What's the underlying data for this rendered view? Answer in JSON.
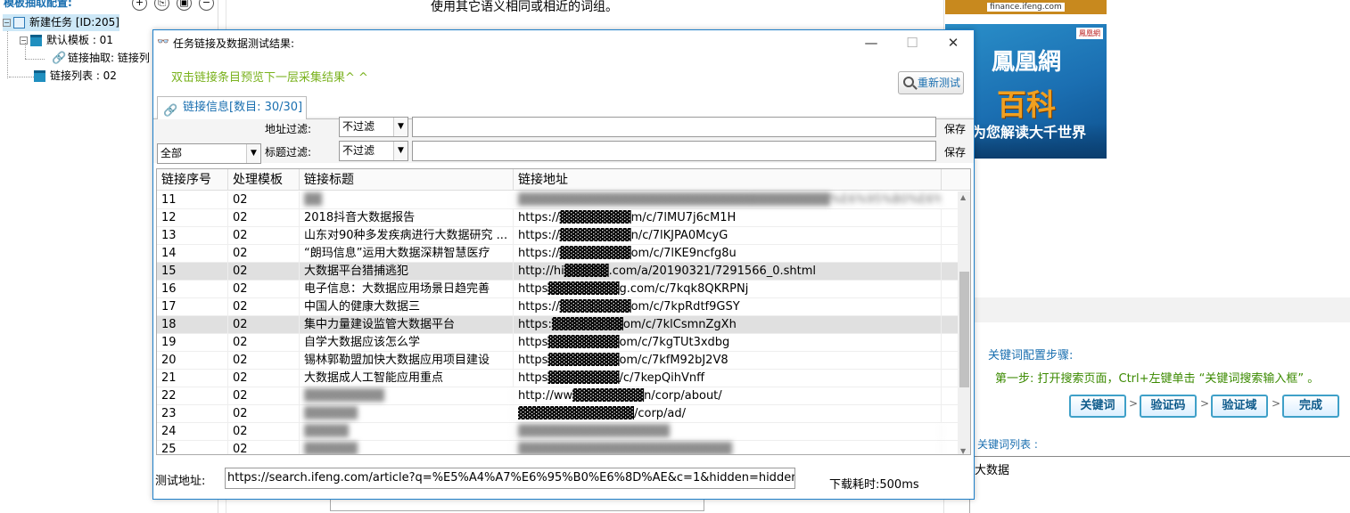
{
  "left_panel": {
    "title": "模板抽取配置:",
    "toolbar_icons": [
      "+",
      "⎘",
      "▣",
      "−"
    ],
    "tree": [
      {
        "label": "新建任务 [ID:205]",
        "level": 0
      },
      {
        "label": "默认模板 : 01",
        "level": 1
      },
      {
        "label": "链接抽取: 链接列",
        "level": 2
      },
      {
        "label": "链接列表 : 02",
        "level": 1
      }
    ]
  },
  "background": {
    "text": "使用其它语义相同或相近的词组。"
  },
  "ads": {
    "ad1_url": "finance.ifeng.com",
    "ad2_brand": "鳳凰網",
    "ad2_product": "百科",
    "ad2_slogan": "为您解读大千世界",
    "ad2_logo": "鳳凰網"
  },
  "right_panel": {
    "steps_title": "关键词配置步骤:",
    "step1": "第一步: 打开搜索页面，Ctrl+左键单击 “关键词搜索输入框” 。",
    "step_buttons": [
      "关键词",
      "验证码",
      "验证域",
      "完成"
    ],
    "keyword_list_label": "关键词列表 :",
    "keywords": [
      "大数据"
    ]
  },
  "dialog": {
    "title": "任务链接及数据测试结果:",
    "hint": "双击链接条目预览下一层采集结果^ ^",
    "retest_label": "重新测试",
    "tab_label": "链接信息[数目: 30/30]",
    "url_filter_label": "地址过滤:",
    "title_filter_label": "标题过滤:",
    "url_filter_value": "不过滤",
    "title_filter_value": "不过滤",
    "scope_value": "全部",
    "save_label": "保存",
    "columns": [
      "链接序号",
      "处理模板",
      "链接标题",
      "链接地址"
    ],
    "rows": [
      {
        "no": "11",
        "tpl": "02",
        "title": "▓▓",
        "url": "▓▓▓▓▓▓▓▓▓▓▓▓▓▓▓▓▓▓▓▓▓▓▓▓▓▓▓▓▓▓▓▓▓▓▓%E6%95%B0%E6%8...",
        "blur_title": true,
        "blur_url": true
      },
      {
        "no": "12",
        "tpl": "02",
        "title": "2018抖音大数据报告",
        "url": "https://▓▓▓▓▓▓▓▓m/c/7lMU7j6cM1H"
      },
      {
        "no": "13",
        "tpl": "02",
        "title": "山东对90种多发疾病进行大数据研究 ...",
        "url": "https://▓▓▓▓▓▓▓▓n/c/7lKJPA0McyG"
      },
      {
        "no": "14",
        "tpl": "02",
        "title": "“朗玛信息”运用大数据深耕智慧医疗",
        "url": "https://▓▓▓▓▓▓▓▓om/c/7lKE9ncfg8u"
      },
      {
        "no": "15",
        "tpl": "02",
        "title": "大数据平台猎捕逃犯",
        "url": "http://hi▓▓▓▓▓.com/a/20190321/7291566_0.shtml",
        "selected": true
      },
      {
        "no": "16",
        "tpl": "02",
        "title": "电子信息：大数据应用场景日趋完善",
        "url": "https▓▓▓▓▓▓▓▓g.com/c/7kqk8QKRPNj"
      },
      {
        "no": "17",
        "tpl": "02",
        "title": "中国人的健康大数据三",
        "url": "https://▓▓▓▓▓▓▓▓om/c/7kpRdtf9GSY"
      },
      {
        "no": "18",
        "tpl": "02",
        "title": "集中力量建设监管大数据平台",
        "url": "https:▓▓▓▓▓▓▓▓om/c/7klCsmnZgXh",
        "selected": true
      },
      {
        "no": "19",
        "tpl": "02",
        "title": "自学大数据应该怎么学",
        "url": "https▓▓▓▓▓▓▓▓om/c/7kgTUt3xdbg"
      },
      {
        "no": "20",
        "tpl": "02",
        "title": "锡林郭勒盟加快大数据应用项目建设",
        "url": "https▓▓▓▓▓▓▓▓om/c/7kfM92bJ2V8"
      },
      {
        "no": "21",
        "tpl": "02",
        "title": "大数据成人工智能应用重点",
        "url": "https▓▓▓▓▓▓▓▓/c/7kepQihVnff"
      },
      {
        "no": "22",
        "tpl": "02",
        "title": "▓▓▓▓▓▓▓▓▓",
        "url": "http://ww▓▓▓▓▓▓▓▓n/corp/about/",
        "blur_title": true
      },
      {
        "no": "23",
        "tpl": "02",
        "title": "▓▓▓▓▓▓",
        "url": "▓▓▓▓▓▓▓▓▓▓▓▓▓/corp/ad/",
        "blur_title": true
      },
      {
        "no": "24",
        "tpl": "02",
        "title": "▓▓▓▓▓",
        "url": "▓▓▓▓▓▓▓▓▓▓▓▓▓▓▓▓▓",
        "blur_title": true,
        "blur_url": true
      },
      {
        "no": "25",
        "tpl": "02",
        "title": "▓▓▓▓▓▓",
        "url": "▓▓▓▓▓▓▓▓▓▓▓▓▓▓▓▓▓▓▓▓▓▓▓▓",
        "blur_title": true,
        "blur_url": true
      }
    ],
    "test_url_label": "测试地址:",
    "test_url_value": "https://search.ifeng.com/article?q=%E5%A4%A7%E6%95%B0%E6%8D%AE&c=1&hidden=hidden&hi",
    "load_time_label": "下载耗时:500ms"
  }
}
